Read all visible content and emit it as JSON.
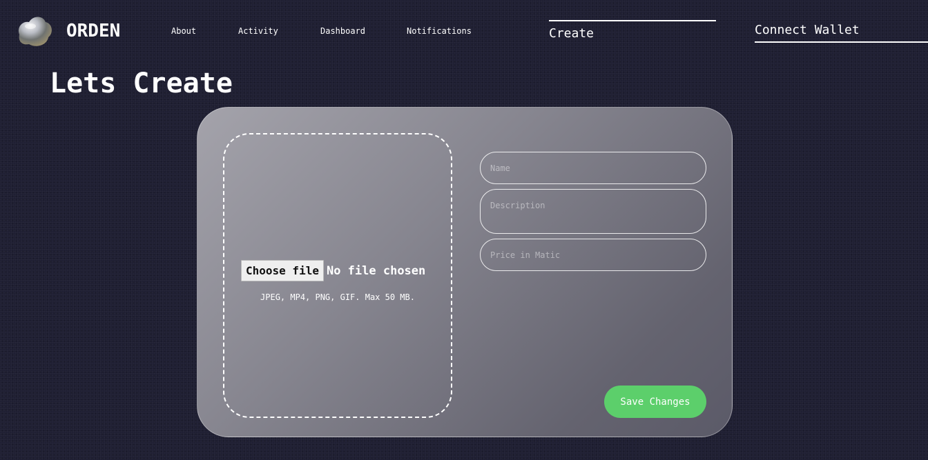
{
  "header": {
    "brand": "ORDEN",
    "nav": {
      "about": "About",
      "activity": "Activity",
      "dashboard": "Dashboard",
      "notifications": "Notifications"
    },
    "create_tab": "Create",
    "connect_wallet": "Connect Wallet"
  },
  "page": {
    "title": "Lets Create"
  },
  "upload": {
    "choose_file_label": "Choose file",
    "file_status": "No file chosen",
    "hint": "JPEG, MP4, PNG, GIF. Max 50 MB."
  },
  "form": {
    "name_placeholder": "Name",
    "description_placeholder": "Description",
    "price_placeholder": "Price in Matic",
    "save_label": "Save Changes"
  },
  "colors": {
    "background": "#1f1f33",
    "save_button": "#5ccf6b",
    "accent_text": "#ffffff"
  },
  "icons": {
    "logo": "chrome-blob-logo-icon"
  }
}
